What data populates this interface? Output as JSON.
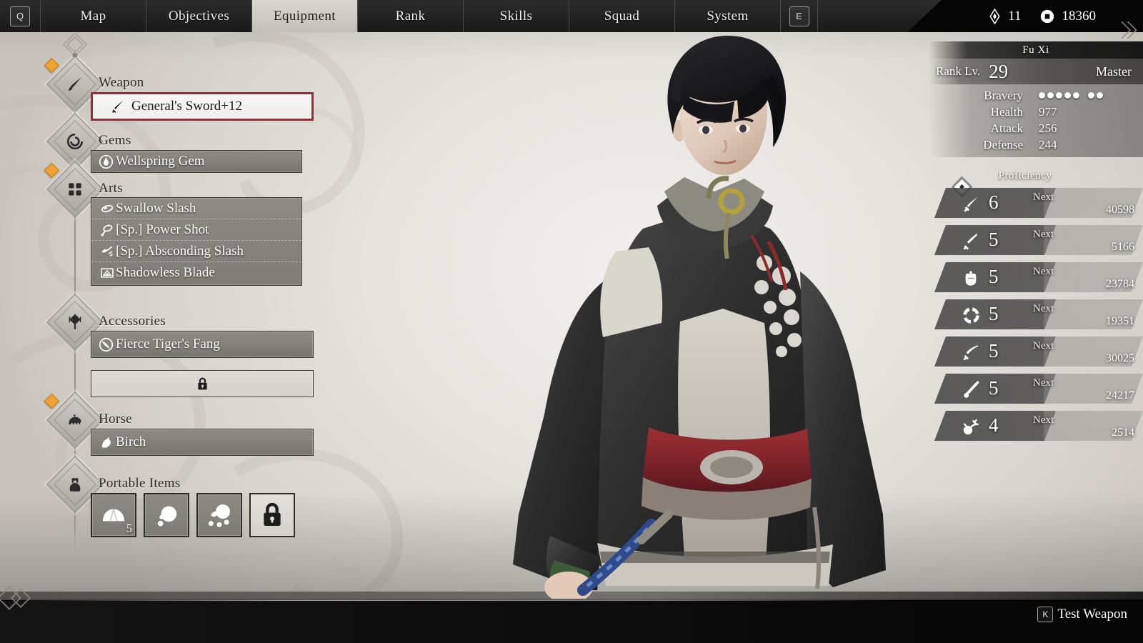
{
  "topbar": {
    "menu_key": "Q",
    "tabs": [
      {
        "label": "Map",
        "active": false
      },
      {
        "label": "Objectives",
        "active": false
      },
      {
        "label": "Equipment",
        "active": true
      },
      {
        "label": "Rank",
        "active": false
      },
      {
        "label": "Skills",
        "active": false
      },
      {
        "label": "Squad",
        "active": false
      },
      {
        "label": "System",
        "active": false
      }
    ],
    "close_key": "E",
    "currency": [
      {
        "icon": "gem-icon",
        "value": "11"
      },
      {
        "icon": "coin-icon",
        "value": "18360"
      }
    ]
  },
  "equipment": {
    "sections": [
      {
        "label": "Weapon",
        "icon": "sword-icon",
        "is_new": true
      },
      {
        "label": "Gems",
        "icon": "gem-swirl-icon",
        "is_new": false
      },
      {
        "label": "Arts",
        "icon": "four-dots-icon",
        "is_new": true
      },
      {
        "label": "Accessories",
        "icon": "pendant-icon",
        "is_new": false
      },
      {
        "label": "Horse",
        "icon": "horse-icon",
        "is_new": true
      },
      {
        "label": "Portable Items",
        "icon": "pouch-icon",
        "is_new": false
      }
    ],
    "weapon_slot": {
      "name": "General's Sword+12",
      "icon": "sword-icon",
      "selected": true
    },
    "gem_slots": [
      {
        "name": "Wellspring Gem",
        "icon": "droplet-gem-icon"
      }
    ],
    "arts_slots": [
      {
        "name": "Swallow Slash",
        "icon": "swallow-icon"
      },
      {
        "name": "[Sp.] Power Shot",
        "icon": "power-shot-icon"
      },
      {
        "name": "[Sp.] Absconding Slash",
        "icon": "absconding-icon"
      },
      {
        "name": "Shadowless Blade",
        "icon": "shadowless-icon"
      }
    ],
    "accessory_slots": [
      {
        "name": "Fierce Tiger's Fang",
        "icon": "fang-icon",
        "locked": false
      },
      {
        "name": "",
        "icon": "lock-icon",
        "locked": true
      }
    ],
    "horse_slots": [
      {
        "name": "Birch",
        "icon": "horse-head-icon"
      }
    ],
    "portable_items": [
      {
        "icon": "bun-icon",
        "qty": "5",
        "locked": false
      },
      {
        "icon": "pouch-small-icon",
        "qty": "",
        "locked": false
      },
      {
        "icon": "pouch-scatter-icon",
        "qty": "",
        "locked": false
      },
      {
        "icon": "lock-icon",
        "qty": "",
        "locked": true
      }
    ]
  },
  "stats": {
    "character_name": "Fu Xi",
    "rank_label": "Rank Lv.",
    "rank_value": "29",
    "rank_title": "Master",
    "rows": [
      {
        "label": "Bravery",
        "value": "",
        "dots_filled": 5,
        "dots_extra": 2
      },
      {
        "label": "Health",
        "value": "977"
      },
      {
        "label": "Attack",
        "value": "256"
      },
      {
        "label": "Defense",
        "value": "244"
      }
    ]
  },
  "proficiency": {
    "label": "Proficiency",
    "next_label": "Next",
    "rows": [
      {
        "icon": "sword-prof-icon",
        "level": "6",
        "next": "40598"
      },
      {
        "icon": "dagger-prof-icon",
        "level": "5",
        "next": "5166"
      },
      {
        "icon": "gauntlet-prof-icon",
        "level": "5",
        "next": "23784"
      },
      {
        "icon": "ring-prof-icon",
        "level": "5",
        "next": "19351"
      },
      {
        "icon": "saber-prof-icon",
        "level": "5",
        "next": "30025"
      },
      {
        "icon": "staff-prof-icon",
        "level": "5",
        "next": "24217"
      },
      {
        "icon": "bomb-prof-icon",
        "level": "4",
        "next": "2514"
      }
    ]
  },
  "footer": {
    "hint_key": "K",
    "hint_label": "Test Weapon"
  },
  "colors": {
    "accent_new": "#f0a233",
    "selected_border": "#8e3039",
    "slot_fill": "#82807b",
    "background": "#dedbd6"
  }
}
